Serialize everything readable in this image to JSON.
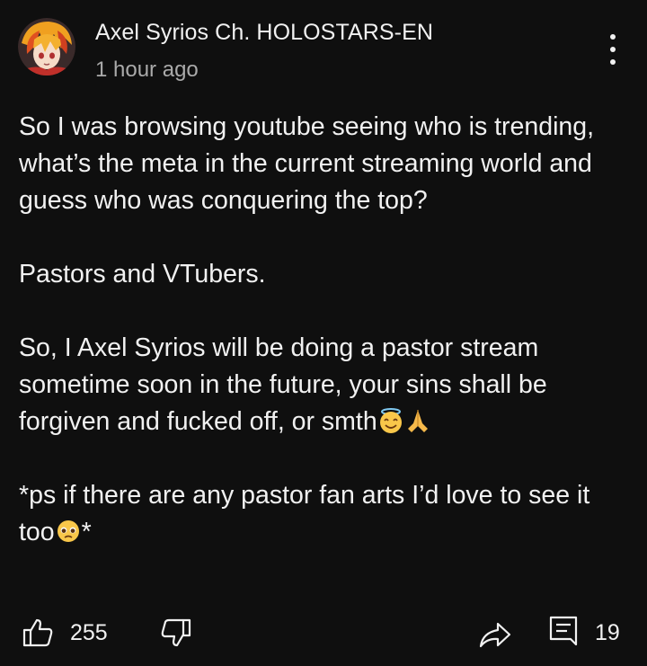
{
  "post": {
    "author": "Axel Syrios Ch. HOLOSTARS-EN",
    "timestamp": "1 hour ago",
    "avatar_icon": "avatar-image",
    "body": {
      "p1": "So I was browsing youtube seeing who is trending, what’s the meta in the current streaming world and guess who was conquering the top?",
      "p2": "Pastors and VTubers.",
      "p3_text": "So, I Axel Syrios will be doing a pastor stream sometime soon in the future, your sins shall be forgiven and fucked off, or smth",
      "p3_emojis": [
        "smiling-face-with-halo",
        "folded-hands"
      ],
      "p4_text": "*ps if there are any pastor fan arts I’d love to see it too",
      "p4_emoji": "pleading-face",
      "p4_suffix": "*"
    }
  },
  "actions": {
    "like_count": "255",
    "comment_count": "19",
    "icons": [
      "thumbs-up-icon",
      "thumbs-down-icon",
      "share-icon",
      "comment-icon",
      "more-vert-icon"
    ]
  }
}
